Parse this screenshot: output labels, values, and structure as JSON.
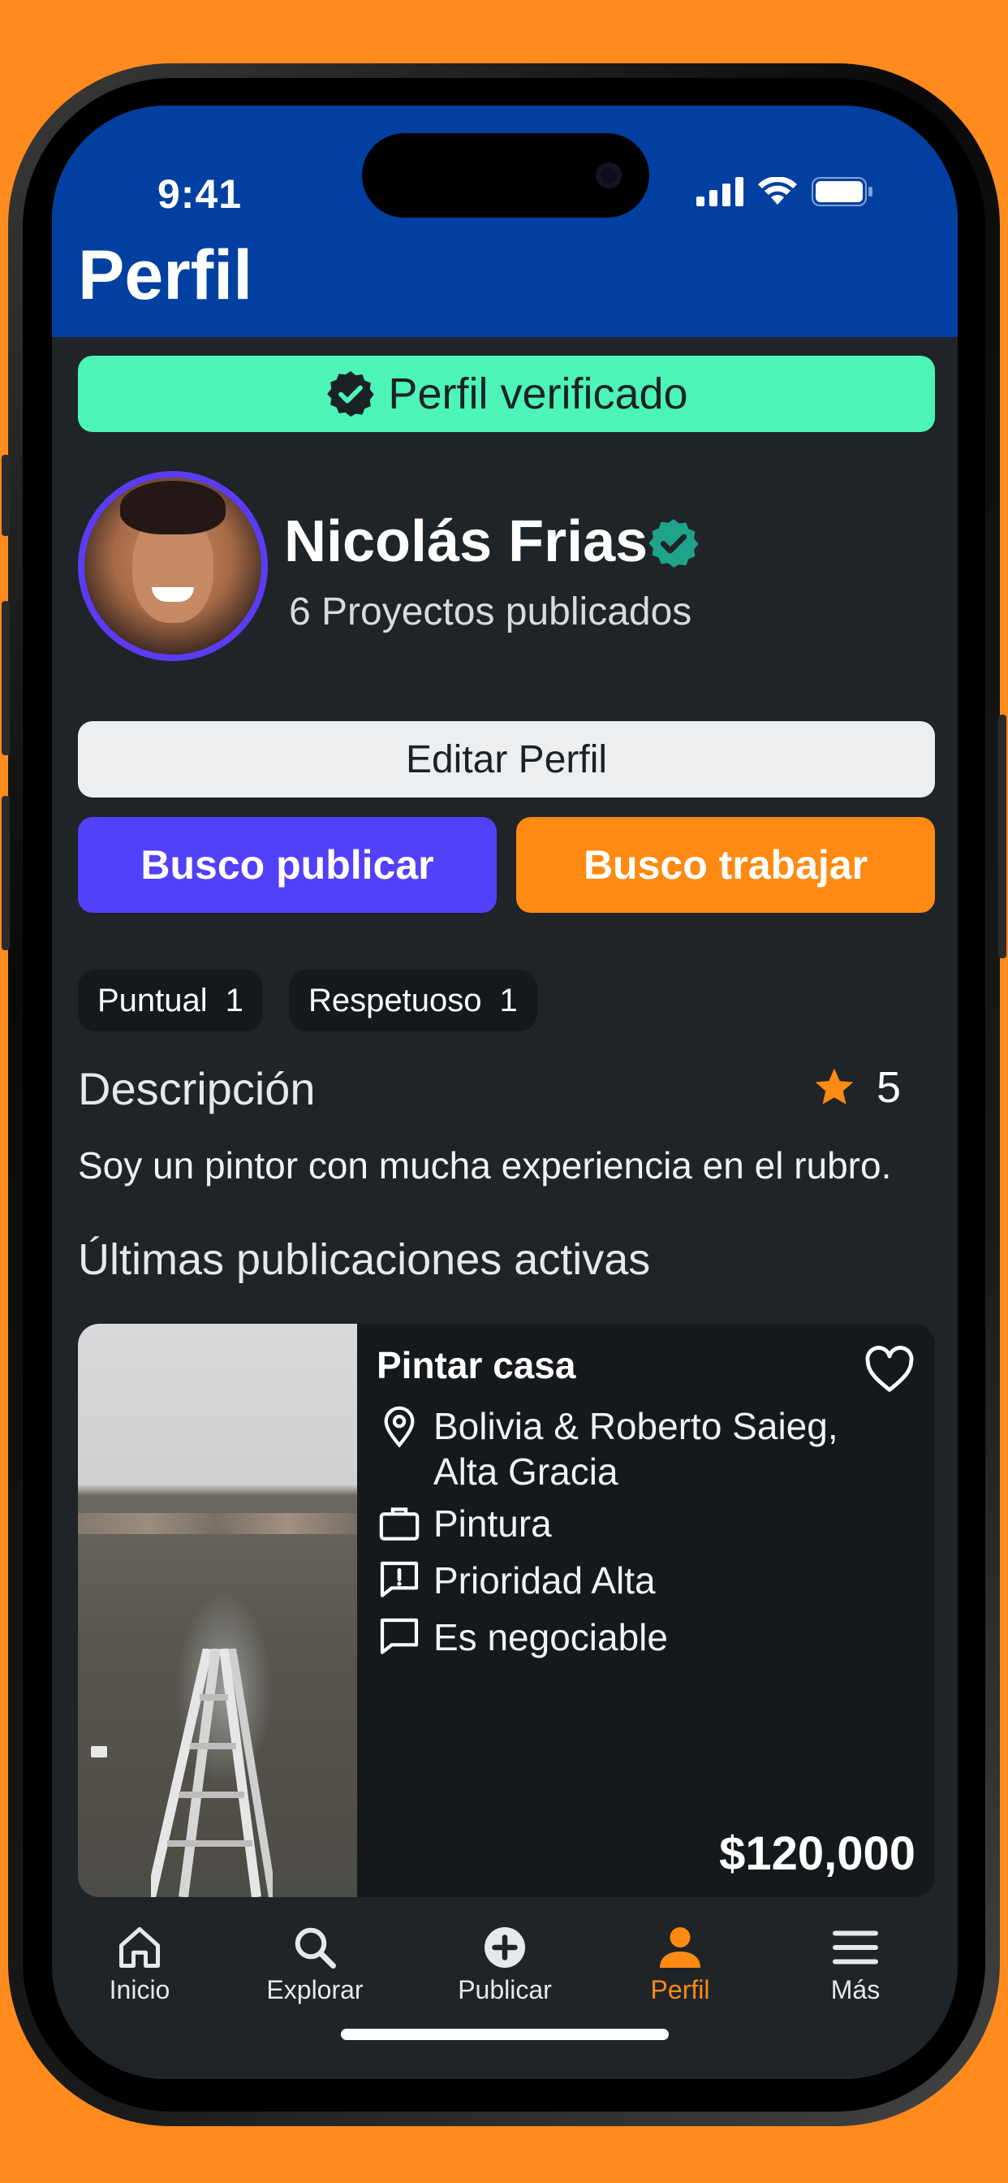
{
  "status_bar": {
    "time": "9:41"
  },
  "header": {
    "title": "Perfil"
  },
  "verified_banner": {
    "label": "Perfil verificado"
  },
  "profile": {
    "name": "Nicolás Frias",
    "projects": "6 Proyectos publicados"
  },
  "actions": {
    "edit": "Editar Perfil",
    "publish": "Busco publicar",
    "work": "Busco trabajar"
  },
  "chips": [
    {
      "label": "Puntual",
      "count": "1"
    },
    {
      "label": "Respetuoso",
      "count": "1"
    }
  ],
  "description": {
    "title": "Descripción",
    "rating": "5",
    "text": "Soy un pintor con mucha experiencia en el rubro."
  },
  "active_section": {
    "title": "Últimas publicaciones activas"
  },
  "publication": {
    "title": "Pintar casa",
    "location_line1": "Bolivia & Roberto Saieg,",
    "location_line2": "Alta Gracia",
    "category": "Pintura",
    "priority": "Prioridad Alta",
    "negotiable": "Es negociable",
    "price": "$120,000"
  },
  "tabs": [
    {
      "label": "Inicio",
      "icon": "home-icon"
    },
    {
      "label": "Explorar",
      "icon": "search-icon"
    },
    {
      "label": "Publicar",
      "icon": "plus-circle-icon"
    },
    {
      "label": "Perfil",
      "icon": "user-icon",
      "active": true
    },
    {
      "label": "Más",
      "icon": "menu-icon"
    }
  ],
  "colors": {
    "background": "#FF8A1E",
    "header": "#0140A0",
    "screen": "#1F2428",
    "verified_banner": "#4CF5B7",
    "primary": "#5340FA",
    "accent": "#FF8A13",
    "verified_badge": "#1FA38A"
  }
}
